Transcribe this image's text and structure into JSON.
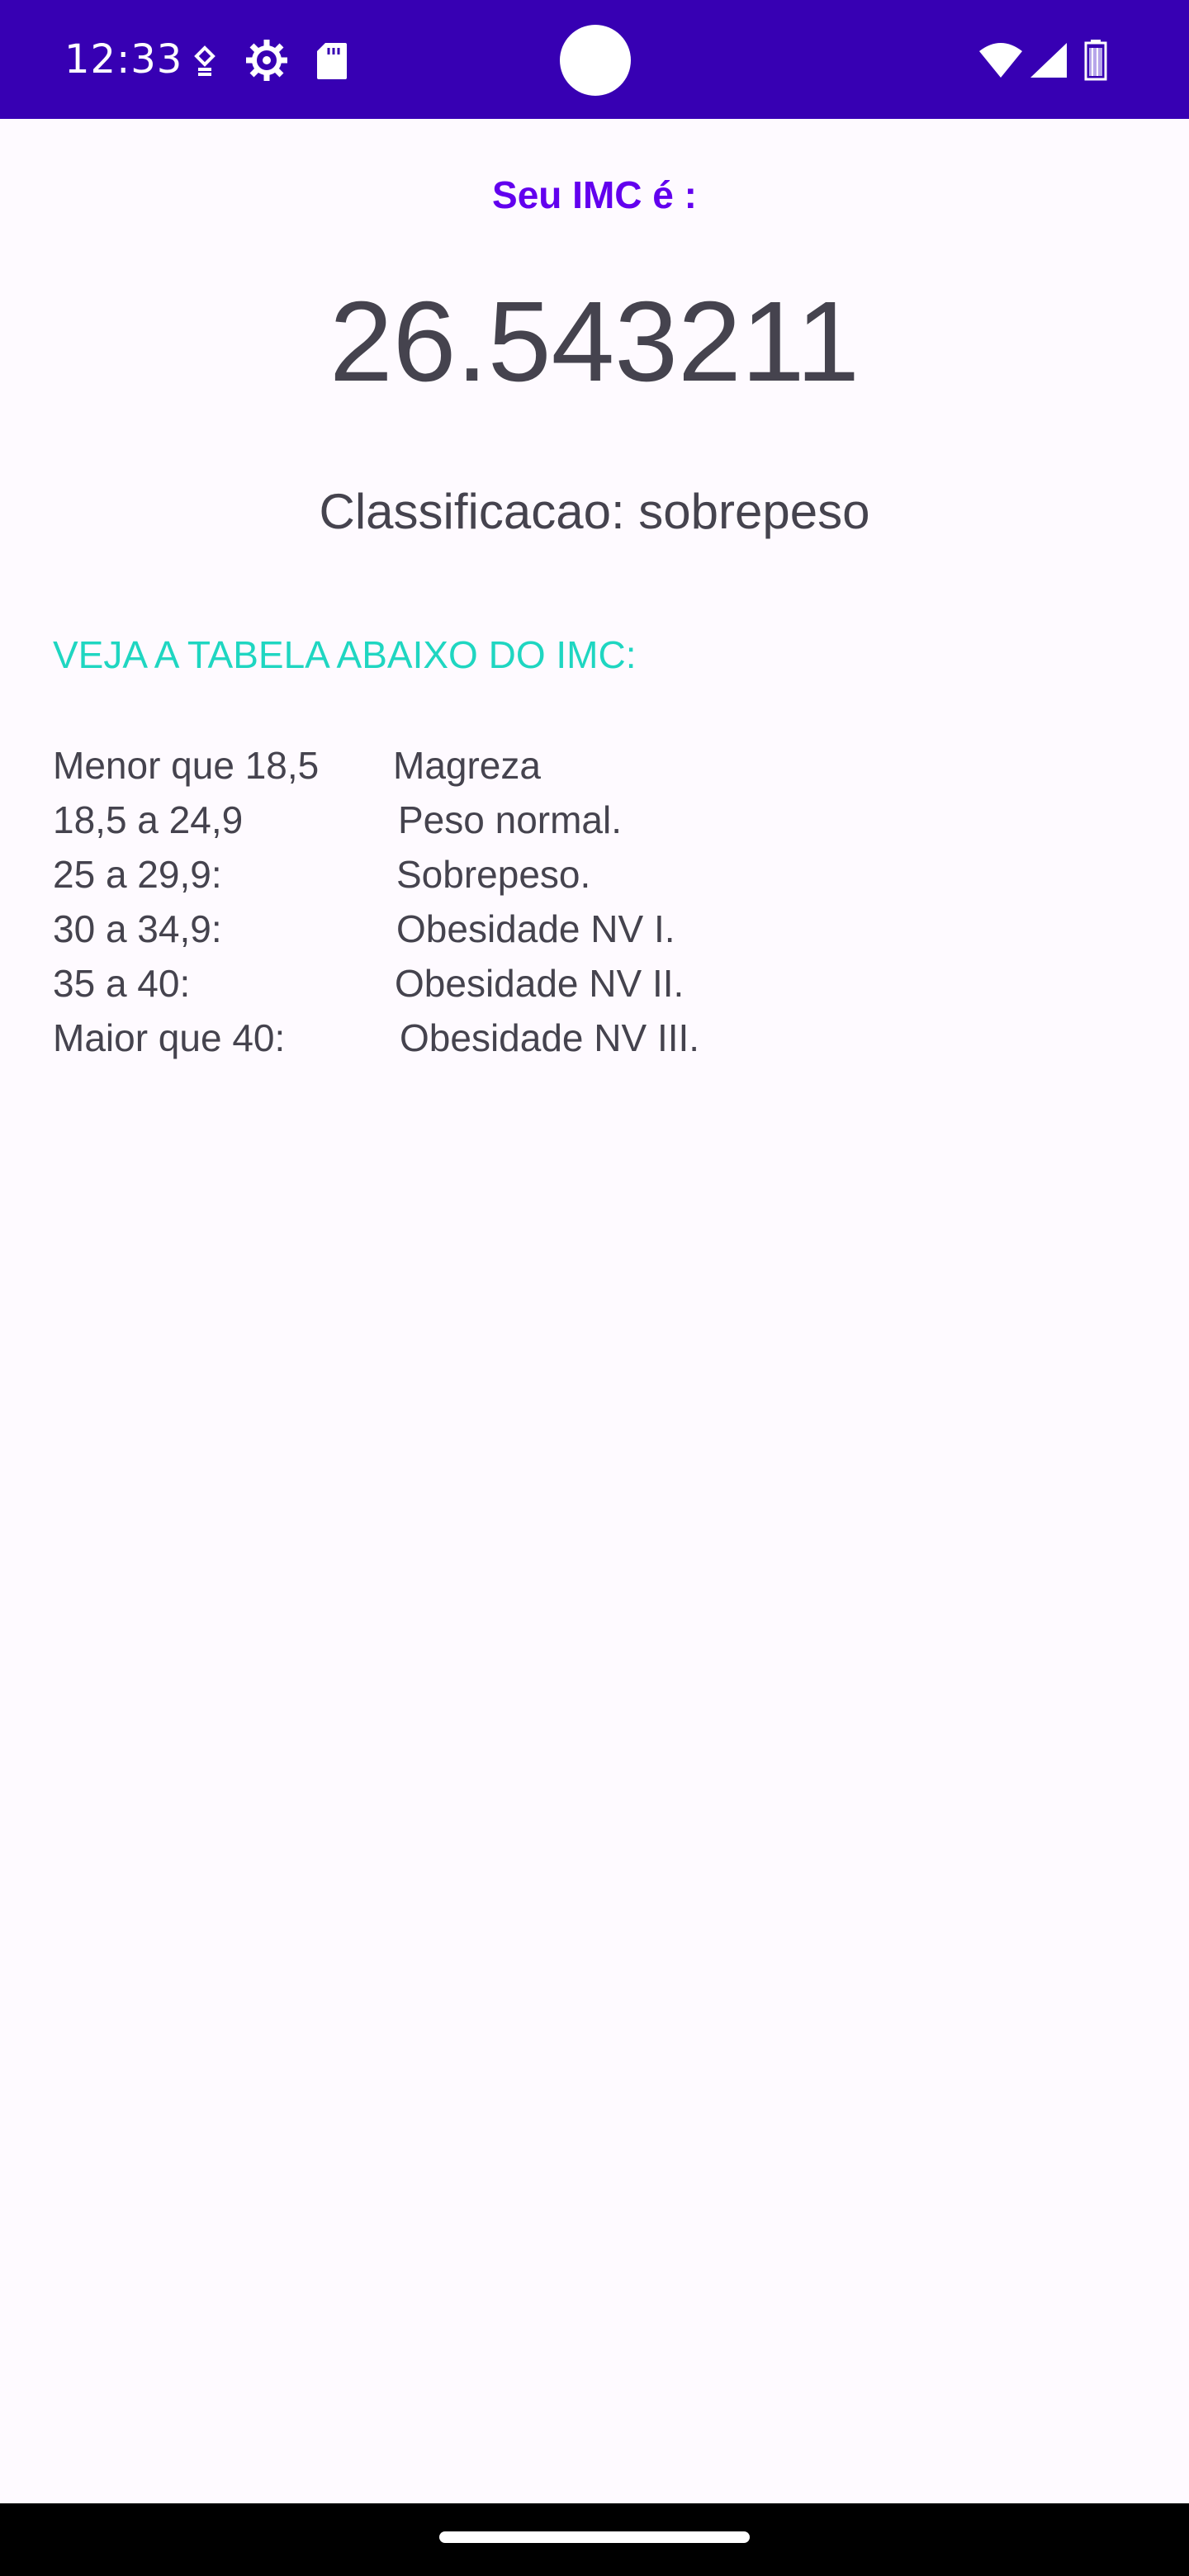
{
  "status_bar": {
    "time": "12:33",
    "icons_left": [
      "notification-small-icon",
      "settings-gear-icon",
      "sd-card-icon"
    ],
    "icons_right": [
      "wifi-icon",
      "signal-icon",
      "battery-icon"
    ],
    "background_color": "#3700b3"
  },
  "result": {
    "label": "Seu IMC é :",
    "value": "26.543211",
    "classification": "Classificacao: sobrepeso",
    "label_color": "#6200ee"
  },
  "table": {
    "heading": "VEJA A TABELA ABAIXO DO IMC:",
    "heading_color": "#1fd6c1",
    "rows": [
      {
        "range": "Menor que 18,5",
        "classification": "Magreza"
      },
      {
        "range": "18,5 a 24,9",
        "classification": "Peso normal."
      },
      {
        "range": "25 a 29,9:",
        "classification": "Sobrepeso."
      },
      {
        "range": "30 a 34,9:",
        "classification": "Obesidade NV I."
      },
      {
        "range": "35 a 40:",
        "classification": "Obesidade NV II."
      },
      {
        "range": "Maior que 40:",
        "classification": "Obesidade NV III."
      }
    ]
  }
}
